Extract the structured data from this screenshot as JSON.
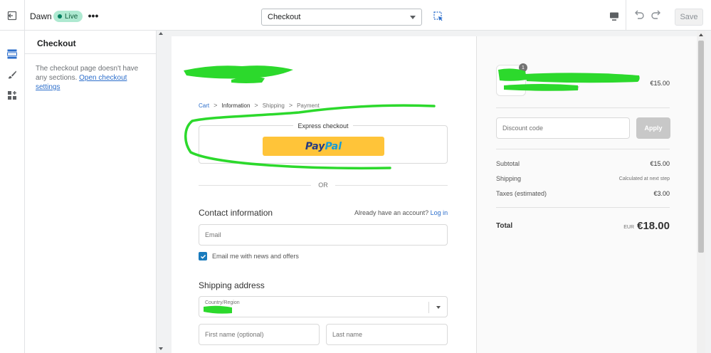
{
  "topbar": {
    "theme_name": "Dawn",
    "live_badge": "Live",
    "more_label": "•••",
    "page_select_value": "Checkout",
    "save_label": "Save"
  },
  "sidebar": {
    "title": "Checkout",
    "message": "The checkout page doesn't have any sections.",
    "settings_link": "Open checkout settings"
  },
  "checkout": {
    "breadcrumb": {
      "cart": "Cart",
      "information": "Information",
      "shipping": "Shipping",
      "payment": "Payment",
      "separator": ">"
    },
    "express_checkout_label": "Express checkout",
    "paypal_pay": "Pay",
    "paypal_pal": "Pal",
    "or_label": "OR",
    "contact_title": "Contact information",
    "have_account_text": "Already have an account?",
    "login_link": "Log in",
    "email_placeholder": "Email",
    "newsletter_label": "Email me with news and offers",
    "shipping_title": "Shipping address",
    "country_label": "Country/Region",
    "first_name_placeholder": "First name (optional)",
    "last_name_placeholder": "Last name"
  },
  "summary": {
    "item_quantity": "1",
    "item_partial_text": "r",
    "item_price": "€15.00",
    "discount_placeholder": "Discount code",
    "apply_label": "Apply",
    "subtotal_label": "Subtotal",
    "subtotal_value": "€15.00",
    "shipping_label": "Shipping",
    "shipping_value": "Calculated at next step",
    "taxes_label": "Taxes (estimated)",
    "taxes_value": "€3.00",
    "total_label": "Total",
    "total_currency": "EUR",
    "total_value": "€18.00"
  },
  "colors": {
    "scribble": "#2cd92c",
    "paypal_button": "#ffc439",
    "link": "#2c6ecb",
    "checkbox": "#197bbd",
    "live_badge": "#aee9d1"
  }
}
